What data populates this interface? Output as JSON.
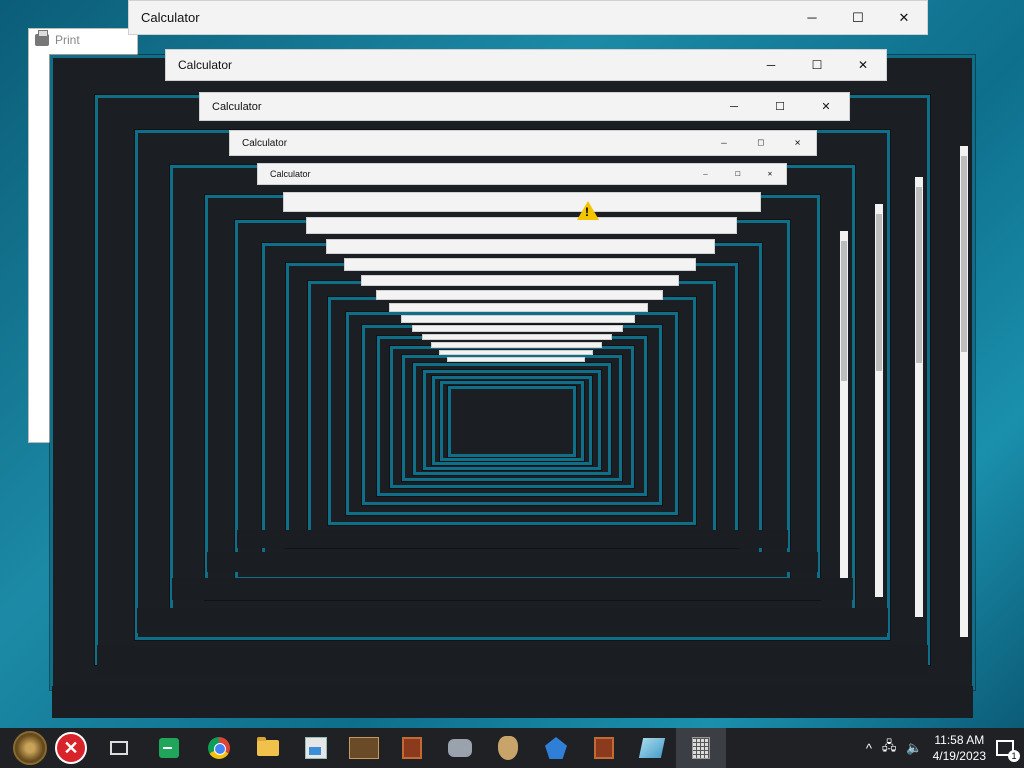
{
  "window": {
    "title": "Calculator",
    "minimize": "─",
    "maximize": "☐",
    "close": "✕"
  },
  "print_dialog": {
    "title": "Print"
  },
  "taskbar": {
    "apps": [
      {
        "name": "app-logo"
      },
      {
        "name": "close-app"
      },
      {
        "name": "task-view"
      },
      {
        "name": "sheets"
      },
      {
        "name": "chrome"
      },
      {
        "name": "file-explorer"
      },
      {
        "name": "photos"
      },
      {
        "name": "movie-app"
      },
      {
        "name": "book-app"
      },
      {
        "name": "people-app"
      },
      {
        "name": "mask-app"
      },
      {
        "name": "network-app"
      },
      {
        "name": "3d-app"
      },
      {
        "name": "calculator"
      }
    ],
    "close_glyph": "✕",
    "tray": {
      "time": "11:58 AM",
      "date": "4/19/2023",
      "chevron": "^",
      "notifications": "1"
    }
  }
}
